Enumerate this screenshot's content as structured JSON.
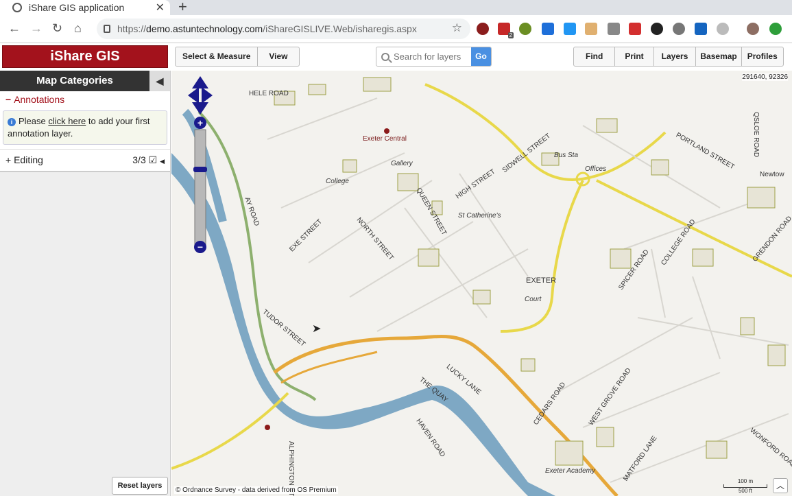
{
  "browser": {
    "tab_title": "iShare GIS application",
    "url_scheme": "https://",
    "url_host": "demo.astuntechnology.com",
    "url_path": "/iShareGISLIVE.Web/isharegis.aspx",
    "ext_badge": "2"
  },
  "app": {
    "brand": "iShare GIS",
    "btn_select_measure": "Select & Measure",
    "btn_view": "View",
    "search_placeholder": "Search for layers",
    "search_go": "Go",
    "btn_find": "Find",
    "btn_print": "Print",
    "btn_layers": "Layers",
    "btn_basemap": "Basemap",
    "btn_profiles": "Profiles"
  },
  "sidebar": {
    "title": "Map Categories",
    "annotations_label": "Annotations",
    "info_pre": "Please ",
    "info_link": "click here",
    "info_post": " to add your first annotation layer.",
    "editing_label": "Editing",
    "editing_count": "3/3",
    "reset_layers": "Reset layers"
  },
  "map": {
    "coords": "291640, 92326",
    "copyright": "© Ordnance Survey - data derived from OS Premium",
    "scale_m": "100 m",
    "scale_ft": "500 ft",
    "labels": {
      "hele_road": "HELE ROAD",
      "exeter_central": "Exeter Central",
      "high_street": "HIGH STREET",
      "sidwell_street": "SIDWELL STREET",
      "portland_street": "PORTLAND STREET",
      "queen_street": "QUEEN STREET",
      "north_street": "NORTH STREET",
      "exe_street": "EXE STREET",
      "tudor_street": "TUDOR STREET",
      "exeter": "EXETER",
      "the_quay": "THE QUAY",
      "lucky_lane": "LUCKY LANE",
      "cedars_road": "CEDARS ROAD",
      "west_grove_road": "WEST GROVE ROAD",
      "matford_lane": "MATFORD LANE",
      "haven_road": "HAVEN ROAD",
      "alphington_st": "ALPHINGTON ST",
      "college_road": "COLLEGE ROAD",
      "spicer_road": "SPICER ROAD",
      "grendon_road": "GRENDON ROAD",
      "wonford_road": "WONFORD ROAD",
      "newtown": "Newtow",
      "ay_road": "AY ROAD",
      "qslde_road": "QSLOE ROAD",
      "st_catherines": "St Catherine's",
      "offices": "Offices",
      "bus_sta": "Bus Sta",
      "college": "College",
      "gallery": "Gallery",
      "court": "Court",
      "exeter_academy": "Exeter Academy"
    }
  }
}
